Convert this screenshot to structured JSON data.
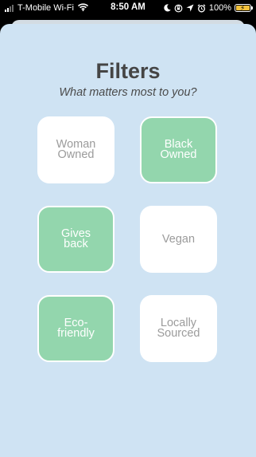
{
  "status_bar": {
    "carrier": "T-Mobile Wi-Fi",
    "time": "8:50 AM",
    "battery": "100%",
    "battery_color": "#f2c13c"
  },
  "screen": {
    "title": "Filters",
    "subtitle": "What matters most to you?"
  },
  "filters": [
    {
      "label": "Woman Owned",
      "selected": false
    },
    {
      "label": "Black Owned",
      "selected": true
    },
    {
      "label": "Gives back",
      "selected": true
    },
    {
      "label": "Vegan",
      "selected": false
    },
    {
      "label": "Eco-friendly",
      "selected": true
    },
    {
      "label": "Locally Sourced",
      "selected": false
    }
  ],
  "colors": {
    "background": "#cfe3f3",
    "selected_tile": "#93d6ad",
    "unselected_tile": "#ffffff",
    "title_text": "#454545"
  }
}
